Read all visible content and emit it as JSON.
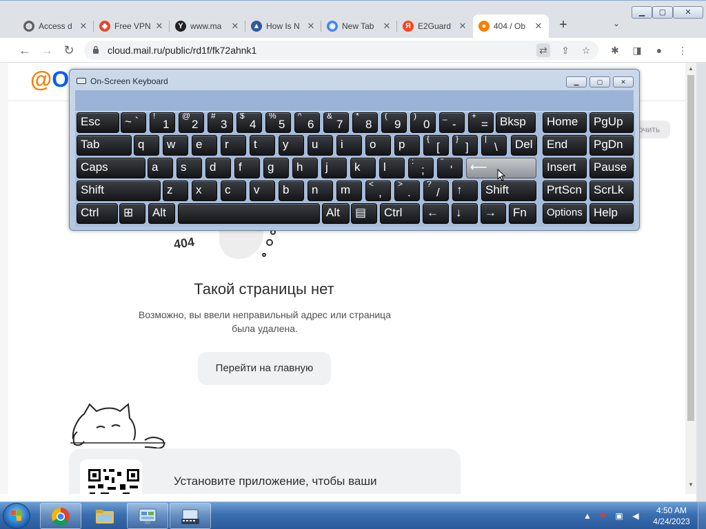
{
  "browser": {
    "tabs": [
      {
        "title": "Access d",
        "icon": "globe-icon",
        "active": false
      },
      {
        "title": "Free VPN",
        "icon": "vpn-icon",
        "active": false
      },
      {
        "title": "www.ma",
        "icon": "yandex-icon",
        "active": false
      },
      {
        "title": "How Is N",
        "icon": "sail-icon",
        "active": false
      },
      {
        "title": "New Tab",
        "icon": "chrome-icon",
        "active": false
      },
      {
        "title": "E2Guard",
        "icon": "yandex-ya-icon",
        "active": false
      },
      {
        "title": "404 / Ob",
        "icon": "cloud-mail-icon",
        "active": true
      }
    ],
    "new_tab_label": "+",
    "url": "cloud.mail.ru/public/rd1f/fk72ahnk1"
  },
  "page": {
    "logo_prefix": "@",
    "logo_text": "Об",
    "side_pill": "очить",
    "error_code": "404",
    "heading": "Такой страницы нет",
    "subtext_line1": "Возможно, вы ввели неправильный адрес или страница",
    "subtext_line2": "была удалена.",
    "home_button": "Перейти на главную",
    "promo_text": "Установите приложение, чтобы ваши"
  },
  "osk": {
    "title": "On-Screen Keyboard",
    "rows": [
      [
        {
          "label": "Esc"
        },
        {
          "label": "~ `"
        },
        {
          "shift": "!",
          "main": "1"
        },
        {
          "shift": "@",
          "main": "2"
        },
        {
          "shift": "#",
          "main": "3"
        },
        {
          "shift": "$",
          "main": "4"
        },
        {
          "shift": "%",
          "main": "5"
        },
        {
          "shift": "^",
          "main": "6"
        },
        {
          "shift": "&",
          "main": "7"
        },
        {
          "shift": "*",
          "main": "8"
        },
        {
          "shift": "(",
          "main": "9"
        },
        {
          "shift": ")",
          "main": "0"
        },
        {
          "shift": "_",
          "main": "-"
        },
        {
          "shift": "+",
          "main": "="
        },
        {
          "label": "Bksp"
        },
        {
          "label": "Home"
        },
        {
          "label": "PgUp"
        }
      ],
      [
        {
          "label": "Tab"
        },
        {
          "label": "q"
        },
        {
          "label": "w"
        },
        {
          "label": "e"
        },
        {
          "label": "r"
        },
        {
          "label": "t"
        },
        {
          "label": "y"
        },
        {
          "label": "u"
        },
        {
          "label": "i"
        },
        {
          "label": "o"
        },
        {
          "label": "p"
        },
        {
          "shift": "{",
          "main": "["
        },
        {
          "shift": "}",
          "main": "]"
        },
        {
          "shift": "|",
          "main": "\\"
        },
        {
          "label": "Del"
        },
        {
          "label": "End"
        },
        {
          "label": "PgDn"
        }
      ],
      [
        {
          "label": "Caps"
        },
        {
          "label": "a"
        },
        {
          "label": "s"
        },
        {
          "label": "d"
        },
        {
          "label": "f"
        },
        {
          "label": "g"
        },
        {
          "label": "h"
        },
        {
          "label": "j"
        },
        {
          "label": "k"
        },
        {
          "label": "l"
        },
        {
          "shift": ":",
          "main": ";"
        },
        {
          "shift": "\"",
          "main": "'"
        },
        {
          "label": "⟵"
        },
        {
          "label": "Insert"
        },
        {
          "label": "Pause"
        }
      ],
      [
        {
          "label": "Shift"
        },
        {
          "label": "z"
        },
        {
          "label": "x"
        },
        {
          "label": "c"
        },
        {
          "label": "v"
        },
        {
          "label": "b"
        },
        {
          "label": "n"
        },
        {
          "label": "m"
        },
        {
          "shift": "<",
          "main": ","
        },
        {
          "shift": ">",
          "main": "."
        },
        {
          "shift": "?",
          "main": "/"
        },
        {
          "label": "↑"
        },
        {
          "label": "Shift"
        },
        {
          "label": "PrtScn"
        },
        {
          "label": "ScrLk"
        }
      ],
      [
        {
          "label": "Ctrl"
        },
        {
          "label": "⊞"
        },
        {
          "label": "Alt"
        },
        {
          "label": ""
        },
        {
          "label": "Alt"
        },
        {
          "label": "▤"
        },
        {
          "label": "Ctrl"
        },
        {
          "label": "←"
        },
        {
          "label": "↓"
        },
        {
          "label": "→"
        },
        {
          "label": "Fn"
        },
        {
          "label": "Options"
        },
        {
          "label": "Help"
        }
      ]
    ]
  },
  "taskbar": {
    "time": "4:50 AM",
    "date": "4/24/2023",
    "apps": [
      "chrome-icon",
      "explorer-icon",
      "control-panel-icon",
      "on-screen-keyboard-icon"
    ]
  },
  "colors": {
    "mail_orange": "#f77f00",
    "mail_blue": "#005ff9",
    "osk_key": "#1a1b1e",
    "taskbar": "#3b6fb0"
  }
}
